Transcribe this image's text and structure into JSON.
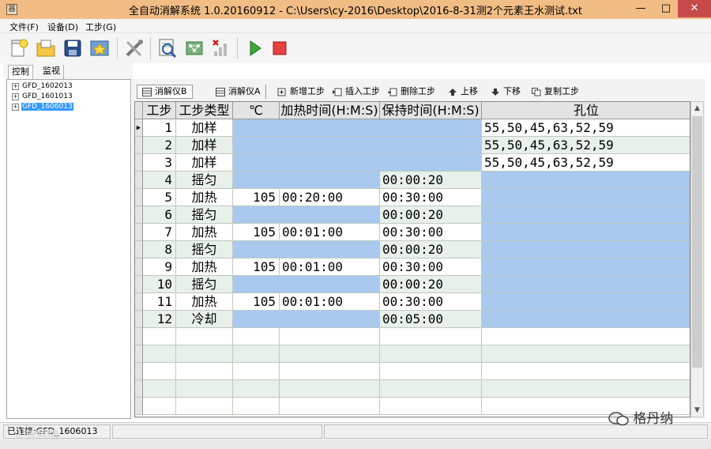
{
  "window": {
    "title": "全自动消解系统 1.0.20160912 - C:\\Users\\cy-2016\\Desktop\\2016-8-31测2个元素王水测试.txt",
    "icon_glyph": "器",
    "min_glyph": "—",
    "max_glyph": "□",
    "close_glyph": "✕"
  },
  "menu": [
    {
      "label": "文件(F)"
    },
    {
      "label": "设备(D)"
    },
    {
      "label": "工步(G)"
    }
  ],
  "toolbar_icons": [
    "new-file-icon",
    "open-folder-icon",
    "save-icon",
    "favorite-icon",
    "tools-icon",
    "search-report-icon",
    "network-icon",
    "signal-icon",
    "play-icon",
    "stop-icon"
  ],
  "left_tabs": [
    {
      "label": "控制"
    },
    {
      "label": "监视"
    }
  ],
  "tree": [
    {
      "label": "GFD_1602013",
      "expander": "+"
    },
    {
      "label": "GFD_1601013",
      "expander": "+"
    },
    {
      "label": "GFD_1606013",
      "expander": "+"
    }
  ],
  "step_toolbar": [
    {
      "label": "消解仪B"
    },
    {
      "label": "消解仪A"
    },
    {
      "label": "新增工步"
    },
    {
      "label": "插入工步"
    },
    {
      "label": "删除工步"
    },
    {
      "label": "上移"
    },
    {
      "label": "下移"
    },
    {
      "label": "复制工步"
    }
  ],
  "grid": {
    "columns": [
      "工步",
      "工步类型",
      "℃",
      "加热时间(H:M:S)",
      "保持时间(H:M:S)",
      "孔位"
    ],
    "row_marker": "▶",
    "rows": [
      {
        "step": "1",
        "type": "加样",
        "temp": "",
        "heat": "",
        "hold": "",
        "holes": "55,50,45,63,52,59"
      },
      {
        "step": "2",
        "type": "加样",
        "temp": "",
        "heat": "",
        "hold": "",
        "holes": "55,50,45,63,52,59"
      },
      {
        "step": "3",
        "type": "加样",
        "temp": "",
        "heat": "",
        "hold": "",
        "holes": "55,50,45,63,52,59"
      },
      {
        "step": "4",
        "type": "摇匀",
        "temp": "",
        "heat": "",
        "hold": "00:00:20",
        "holes": ""
      },
      {
        "step": "5",
        "type": "加热",
        "temp": "105",
        "heat": "00:20:00",
        "hold": "00:30:00",
        "holes": ""
      },
      {
        "step": "6",
        "type": "摇匀",
        "temp": "",
        "heat": "",
        "hold": "00:00:20",
        "holes": ""
      },
      {
        "step": "7",
        "type": "加热",
        "temp": "105",
        "heat": "00:01:00",
        "hold": "00:30:00",
        "holes": ""
      },
      {
        "step": "8",
        "type": "摇匀",
        "temp": "",
        "heat": "",
        "hold": "00:00:20",
        "holes": ""
      },
      {
        "step": "9",
        "type": "加热",
        "temp": "105",
        "heat": "00:01:00",
        "hold": "00:30:00",
        "holes": ""
      },
      {
        "step": "10",
        "type": "摇匀",
        "temp": "",
        "heat": "",
        "hold": "00:00:20",
        "holes": ""
      },
      {
        "step": "11",
        "type": "加热",
        "temp": "105",
        "heat": "00:01:00",
        "hold": "00:30:00",
        "holes": ""
      },
      {
        "step": "12",
        "type": "冷却",
        "temp": "",
        "heat": "",
        "hold": "00:05:00",
        "holes": ""
      }
    ],
    "empty_rows": 5
  },
  "scrollbar": {
    "up": "▲",
    "down": "▼"
  },
  "status": {
    "connection": "已连接:GFD_1606013"
  },
  "watermarks": {
    "left": "人放喷镜",
    "right": "格丹纳"
  },
  "colors": {
    "titlebar": "#f1bd85",
    "selected_cell": "#a9c9ef",
    "tree_selection": "#3399ff",
    "close_button": "#c74a4a"
  }
}
